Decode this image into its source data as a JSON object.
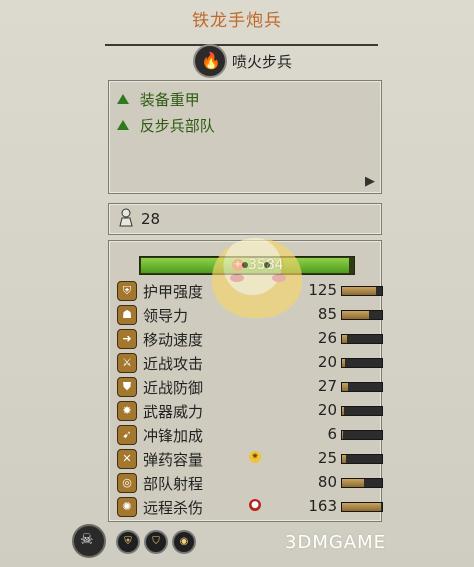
{
  "title": "铁龙手炮兵",
  "unit_type": "喷火步兵",
  "abilities": [
    {
      "label": "装备重甲"
    },
    {
      "label": "反步兵部队"
    }
  ],
  "men": {
    "value": "28"
  },
  "health": {
    "value": "3584",
    "fill_fraction": 0.98
  },
  "stats": [
    {
      "label": "护甲强度",
      "value": "125",
      "bar_fraction": 0.85,
      "icon": "armor-icon"
    },
    {
      "label": "领导力",
      "value": "85",
      "bar_fraction": 0.68,
      "icon": "leadership-icon"
    },
    {
      "label": "移动速度",
      "value": "26",
      "bar_fraction": 0.12,
      "icon": "speed-icon"
    },
    {
      "label": "近战攻击",
      "value": "20",
      "bar_fraction": 0.08,
      "icon": "melee-attack-icon"
    },
    {
      "label": "近战防御",
      "value": "27",
      "bar_fraction": 0.14,
      "icon": "melee-defense-icon"
    },
    {
      "label": "武器威力",
      "value": "20",
      "bar_fraction": 0.06,
      "icon": "weapon-strength-icon"
    },
    {
      "label": "冲锋加成",
      "value": "6",
      "bar_fraction": 0.03,
      "icon": "charge-bonus-icon"
    },
    {
      "label": "弹药容量",
      "value": "25",
      "bar_fraction": 0.1,
      "icon": "ammunition-icon",
      "bonus": "gold"
    },
    {
      "label": "部队射程",
      "value": "80",
      "bar_fraction": 0.55,
      "icon": "range-icon"
    },
    {
      "label": "远程杀伤",
      "value": "163",
      "bar_fraction": 0.98,
      "icon": "missile-damage-icon",
      "bonus": "red"
    }
  ],
  "bottom_icons": [
    "unit-portrait-icon",
    "attribute-icon-1",
    "attribute-icon-2",
    "attribute-icon-3"
  ],
  "watermark": "3DMGAME",
  "colors": {
    "title": "#c06a2a",
    "ability_text": "#2f5b13",
    "health_fill": "#6fc331",
    "stat_fill": "#b28b4a"
  }
}
